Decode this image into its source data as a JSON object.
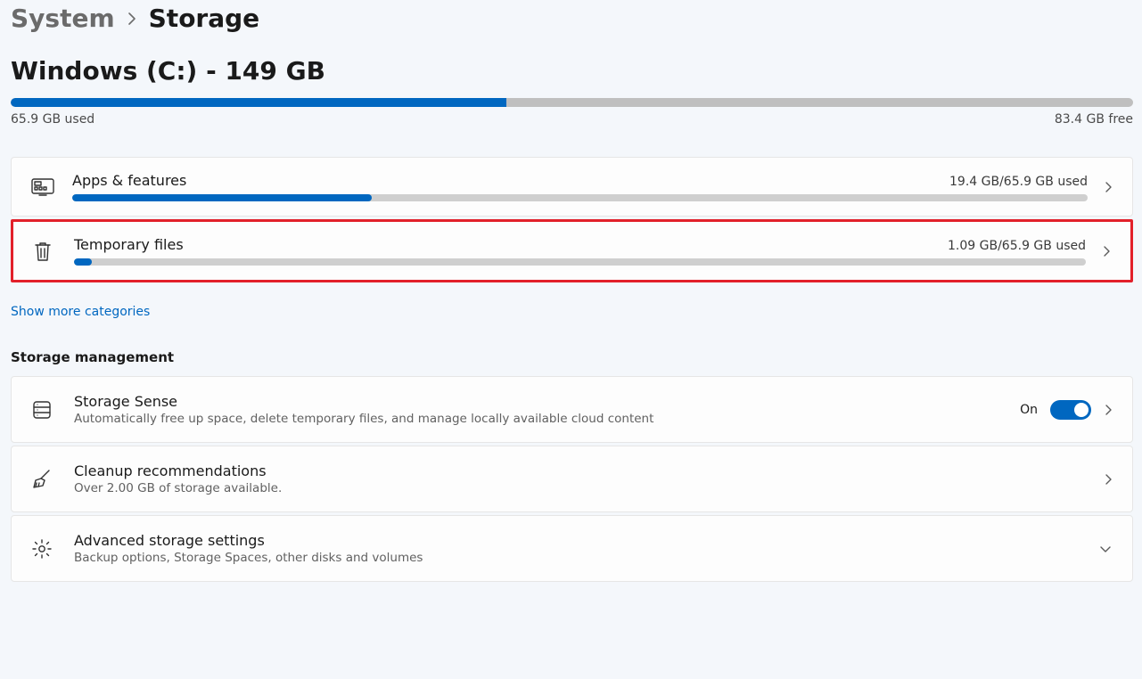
{
  "breadcrumb": {
    "parent": "System",
    "current": "Storage"
  },
  "drive": {
    "title": "Windows (C:) - 149 GB",
    "used_label": "65.9 GB used",
    "free_label": "83.4 GB free",
    "fill_pct": "44.2%"
  },
  "categories": [
    {
      "name": "Apps & features",
      "usage": "19.4 GB/65.9 GB used",
      "fill_pct": "29.5%",
      "icon": "apps",
      "highlighted": false
    },
    {
      "name": "Temporary files",
      "usage": "1.09 GB/65.9 GB used",
      "fill_pct": "1.8%",
      "icon": "trash",
      "highlighted": true
    }
  ],
  "show_more": "Show more categories",
  "management": {
    "header": "Storage management",
    "items": [
      {
        "title": "Storage Sense",
        "sub": "Automatically free up space, delete temporary files, and manage locally available cloud content",
        "icon": "disk",
        "toggle": {
          "state_label": "On"
        },
        "chev": "right"
      },
      {
        "title": "Cleanup recommendations",
        "sub": "Over 2.00 GB of storage available.",
        "icon": "broom",
        "chev": "right"
      },
      {
        "title": "Advanced storage settings",
        "sub": "Backup options, Storage Spaces, other disks and volumes",
        "icon": "gear",
        "chev": "down"
      }
    ]
  }
}
